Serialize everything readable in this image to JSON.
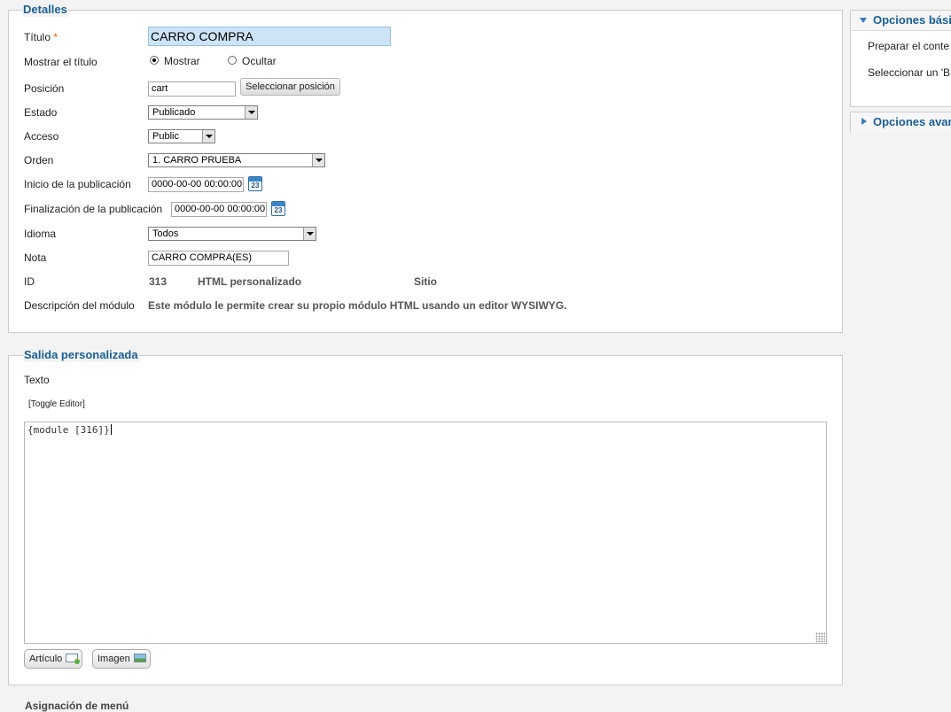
{
  "details": {
    "legend": "Detalles",
    "title_label": "Título",
    "required_mark": "*",
    "title_value": "CARRO COMPRA",
    "show_title_label": "Mostrar el título",
    "show_option": "Mostrar",
    "hide_option": "Ocultar",
    "show_title_selected": "Mostrar",
    "position_label": "Posición",
    "position_value": "cart",
    "select_position_button": "Seleccionar posición",
    "status_label": "Estado",
    "status_value": "Publicado",
    "access_label": "Acceso",
    "access_value": "Public",
    "order_label": "Orden",
    "order_value": "1. CARRO PRUEBA",
    "publish_start_label": "Inicio de la publicación",
    "publish_start_value": "0000-00-00 00:00:00",
    "publish_end_label": "Finalización de la publicación",
    "publish_end_value": "0000-00-00 00:00:00",
    "calendar_icon_text": "23",
    "language_label": "Idioma",
    "language_value": "Todos",
    "note_label": "Nota",
    "note_value": "CARRO COMPRA(ES)",
    "id_label": "ID",
    "id_value": "313",
    "module_type": "HTML personalizado",
    "client": "Sitio",
    "description_label": "Descripción del módulo",
    "description_value": "Este módulo le permite crear su propio módulo HTML usando un editor WYSIWYG."
  },
  "custom_output": {
    "legend": "Salida personalizada",
    "text_label": "Texto",
    "toggle_editor": "[Toggle Editor]",
    "editor_content": "{module [316]}",
    "article_button": "Artículo",
    "image_button": "Imagen"
  },
  "sidebar": {
    "basic_options_title": "Opciones bási",
    "basic_line1": "Preparar el conte",
    "basic_line2": "Seleccionar un 'B",
    "advanced_options_title": "Opciones avan"
  },
  "next_section_partial": "Asignación de menú"
}
